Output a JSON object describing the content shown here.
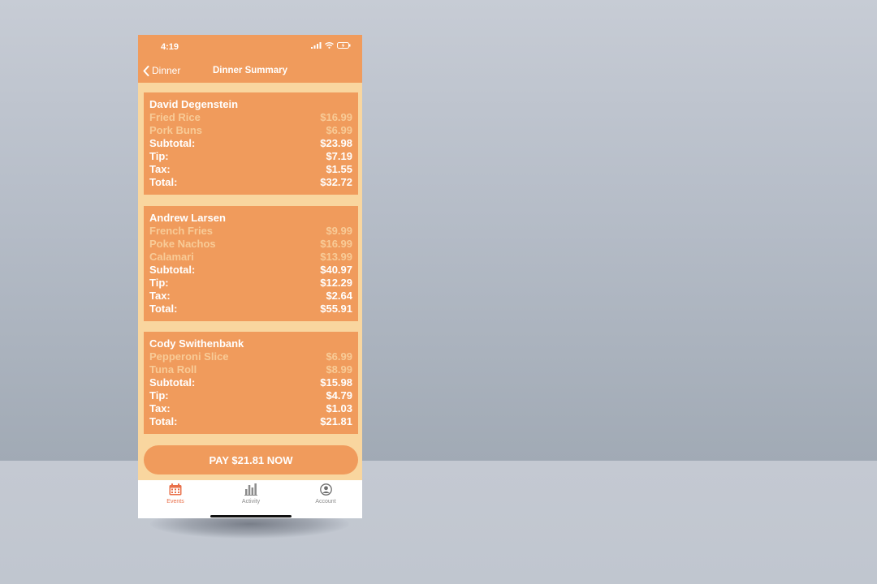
{
  "status_bar": {
    "time": "4:19"
  },
  "nav": {
    "back_label": "Dinner",
    "title": "Dinner Summary"
  },
  "people": [
    {
      "name": "David Degenstein",
      "items": [
        {
          "name": "Fried Rice",
          "price": "$16.99"
        },
        {
          "name": "Pork Buns",
          "price": "$6.99"
        }
      ],
      "summary": [
        {
          "label": "Subtotal:",
          "value": "$23.98"
        },
        {
          "label": "Tip:",
          "value": "$7.19"
        },
        {
          "label": "Tax:",
          "value": "$1.55"
        },
        {
          "label": "Total:",
          "value": "$32.72"
        }
      ]
    },
    {
      "name": "Andrew Larsen",
      "items": [
        {
          "name": "French Fries",
          "price": "$9.99"
        },
        {
          "name": "Poke Nachos",
          "price": "$16.99"
        },
        {
          "name": "Calamari",
          "price": "$13.99"
        }
      ],
      "summary": [
        {
          "label": "Subtotal:",
          "value": "$40.97"
        },
        {
          "label": "Tip:",
          "value": "$12.29"
        },
        {
          "label": "Tax:",
          "value": "$2.64"
        },
        {
          "label": "Total:",
          "value": "$55.91"
        }
      ]
    },
    {
      "name": "Cody Swithenbank",
      "items": [
        {
          "name": "Pepperoni Slice",
          "price": "$6.99"
        },
        {
          "name": "Tuna Roll",
          "price": "$8.99"
        }
      ],
      "summary": [
        {
          "label": "Subtotal:",
          "value": "$15.98"
        },
        {
          "label": "Tip:",
          "value": "$4.79"
        },
        {
          "label": "Tax:",
          "value": "$1.03"
        },
        {
          "label": "Total:",
          "value": "$21.81"
        }
      ]
    }
  ],
  "pay_button": {
    "label": "PAY $21.81 NOW"
  },
  "tabs": [
    {
      "label": "Events",
      "icon": "calendar-icon",
      "active": true
    },
    {
      "label": "Activity",
      "icon": "bar-chart-icon",
      "active": false
    },
    {
      "label": "Account",
      "icon": "account-icon",
      "active": false
    }
  ],
  "colors": {
    "header": "#f09b5c",
    "background": "#f9d69f",
    "item_text": "#f8cb97",
    "active_tab": "#e9704a"
  }
}
